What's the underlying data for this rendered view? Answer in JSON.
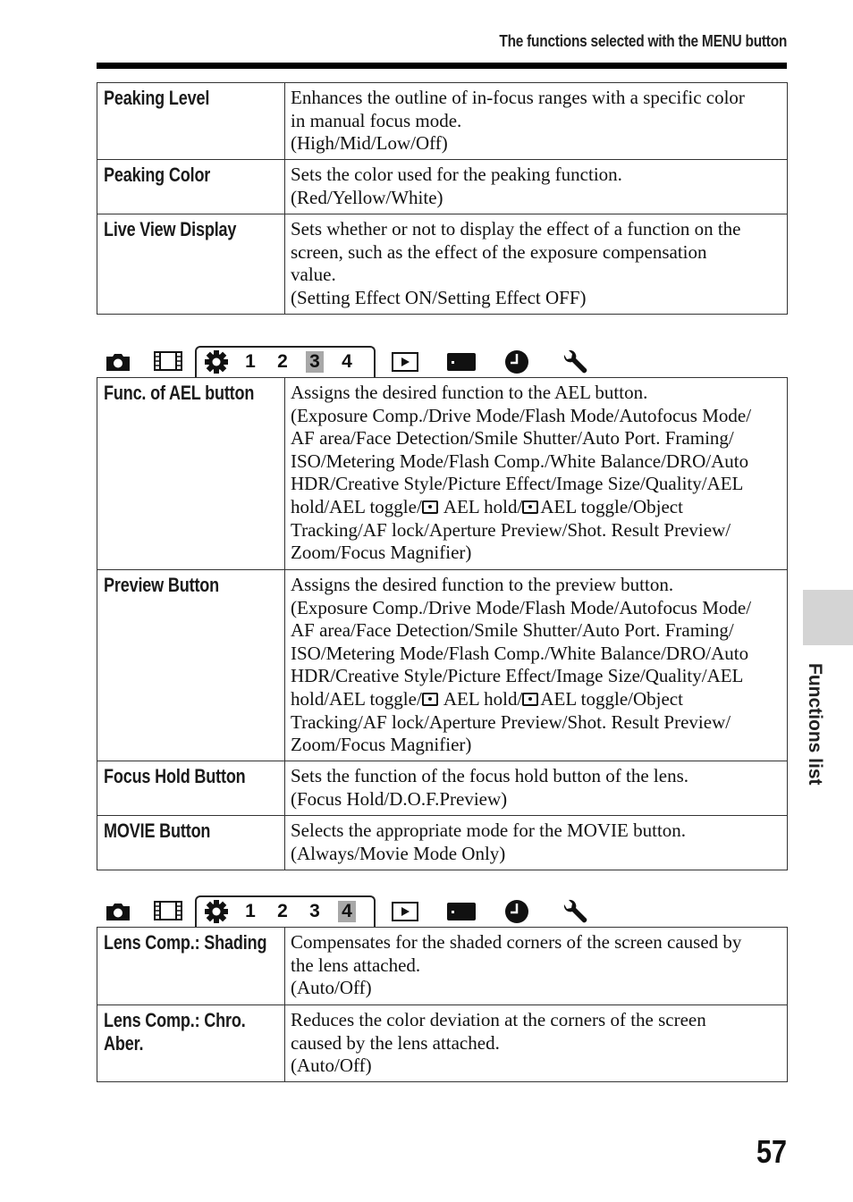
{
  "header": {
    "title": "The functions selected with the MENU button"
  },
  "tables": [
    {
      "rows": [
        {
          "name": "Peaking Level",
          "desc": [
            "Enhances the outline of in-focus ranges with a specific color",
            "in manual focus mode.",
            "(High/Mid/Low/Off)"
          ]
        },
        {
          "name": "Peaking Color",
          "desc": [
            "Sets the color used for the peaking function.",
            "(Red/Yellow/White)"
          ]
        },
        {
          "name": "Live View Display",
          "desc": [
            "Sets whether or not to display the effect of a function on the",
            "screen, such as the effect of the exposure compensation",
            "value.",
            "(Setting Effect ON/Setting Effect OFF)"
          ]
        }
      ]
    },
    {
      "rows": [
        {
          "name": "Func. of AEL button",
          "desc": [
            "Assigns the desired function to the AEL button.",
            "(Exposure Comp./Drive Mode/Flash Mode/Autofocus Mode/",
            "AF area/Face Detection/Smile Shutter/Auto Port. Framing/",
            "ISO/Metering Mode/Flash Comp./White Balance/DRO/Auto",
            "HDR/Creative Style/Picture Effect/Image Size/Quality/AEL"
          ],
          "desc_ael": {
            "pre": "hold/AEL toggle/",
            "mid": " AEL hold/",
            "post": "AEL toggle/Object"
          },
          "desc_tail": [
            "Tracking/AF lock/Aperture Preview/Shot. Result Preview/",
            "Zoom/Focus Magnifier)"
          ]
        },
        {
          "name": "Preview Button",
          "desc": [
            "Assigns the desired function to the preview button.",
            "(Exposure Comp./Drive Mode/Flash Mode/Autofocus Mode/",
            "AF area/Face Detection/Smile Shutter/Auto Port. Framing/",
            "ISO/Metering Mode/Flash Comp./White Balance/DRO/Auto",
            "HDR/Creative Style/Picture Effect/Image Size/Quality/AEL"
          ],
          "desc_ael": {
            "pre": "hold/AEL toggle/",
            "mid": " AEL hold/",
            "post": "AEL toggle/Object"
          },
          "desc_tail": [
            "Tracking/AF lock/Aperture Preview/Shot. Result Preview/",
            "Zoom/Focus Magnifier)"
          ]
        },
        {
          "name": "Focus Hold Button",
          "desc": [
            "Sets the function of the focus hold button of the lens.",
            "(Focus Hold/D.O.F.Preview)"
          ]
        },
        {
          "name": "MOVIE Button",
          "desc": [
            "Selects the appropriate mode for the MOVIE button.",
            "(Always/Movie Mode Only)"
          ]
        }
      ]
    },
    {
      "rows": [
        {
          "name": "Lens Comp.: Shading",
          "desc": [
            "Compensates for the shaded corners of the screen caused by",
            "the lens attached.",
            "(Auto/Off)"
          ]
        },
        {
          "name": "Lens Comp.: Chro.",
          "name2": "Aber.",
          "desc": [
            "Reduces the color deviation at the corners of the screen",
            "caused by the lens attached.",
            "(Auto/Off)"
          ]
        }
      ]
    }
  ],
  "tabbars": [
    {
      "numbers": [
        "1",
        "2",
        "3",
        "4"
      ],
      "active": "3",
      "icons": [
        "camera-icon",
        "movie-film-icon",
        "custom-settings-gear-icon",
        "playback-icon",
        "memory-card-icon",
        "clock-icon",
        "setup-wrench-icon"
      ]
    },
    {
      "numbers": [
        "1",
        "2",
        "3",
        "4"
      ],
      "active": "4",
      "icons": [
        "camera-icon",
        "movie-film-icon",
        "custom-settings-gear-icon",
        "playback-icon",
        "memory-card-icon",
        "clock-icon",
        "setup-wrench-icon"
      ]
    }
  ],
  "side_tab": {
    "label": "Functions list",
    "color": "#d4d4d4"
  },
  "page_number": "57"
}
